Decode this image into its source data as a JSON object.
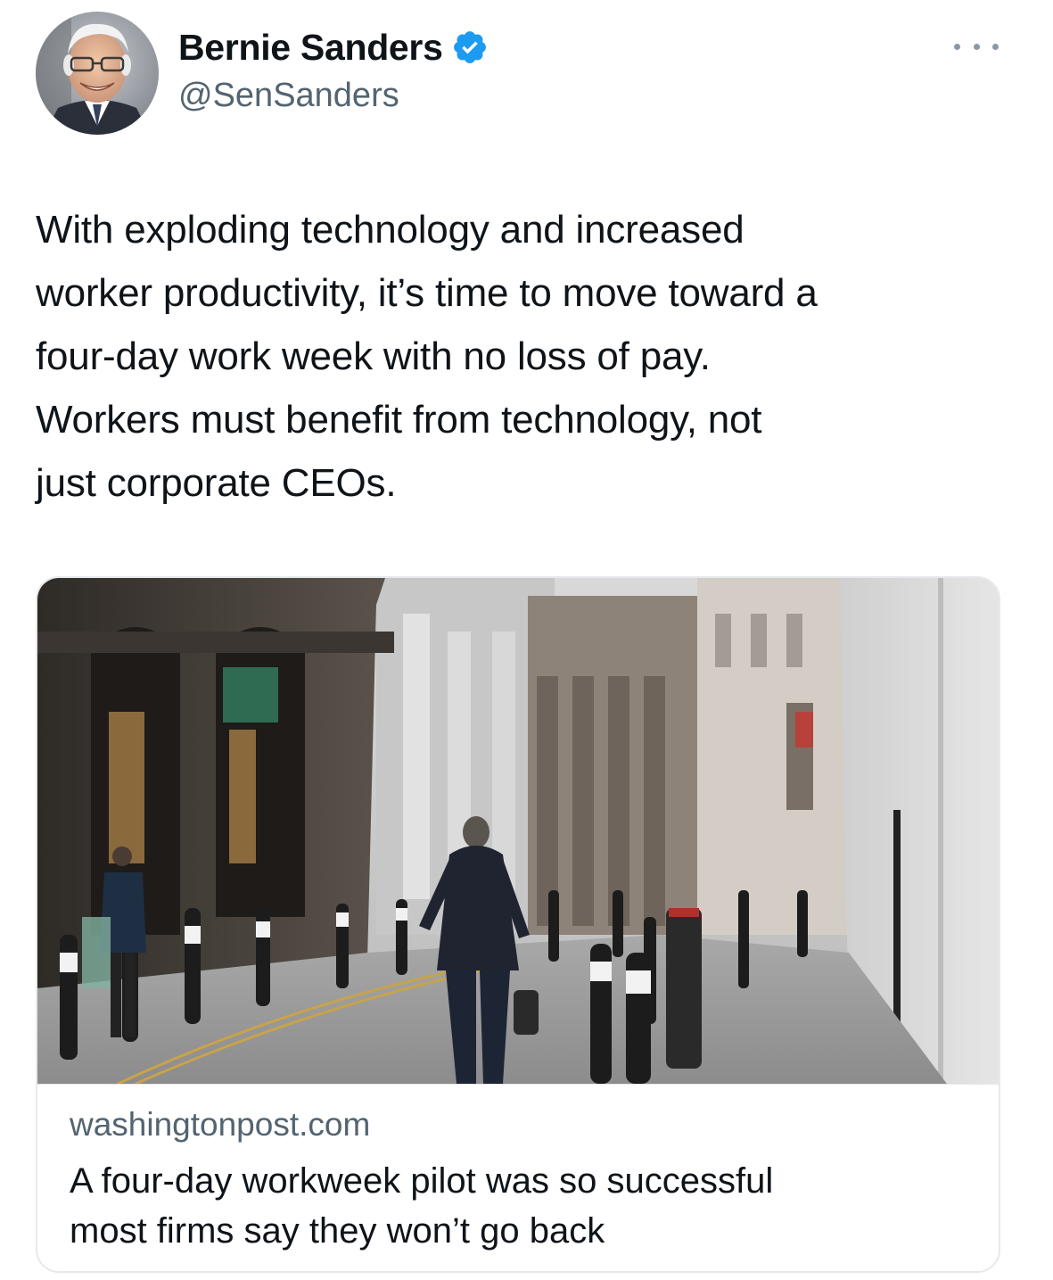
{
  "author": {
    "display_name": "Bernie Sanders",
    "handle": "@SenSanders",
    "verified": true,
    "avatar_icon": "profile-photo"
  },
  "tweet": {
    "text": "With exploding technology and increased\nworker productivity, it’s time to move toward a\nfour-day work week with no loss of pay.\nWorkers must benefit from technology, not\njust corporate CEOs."
  },
  "link_card": {
    "domain": "washingtonpost.com",
    "title": "A four-day workweek pilot was so successful\nmost firms say they won’t go back",
    "image_icon": "street-photo"
  },
  "colors": {
    "text_primary": "#0f1419",
    "text_secondary": "#536471",
    "verified_blue": "#1d9bf0",
    "card_border": "#e6e9ec",
    "more_dots": "#8b98a5"
  },
  "icons": {
    "verified": "verified-badge-icon",
    "more": "more-options-icon"
  }
}
